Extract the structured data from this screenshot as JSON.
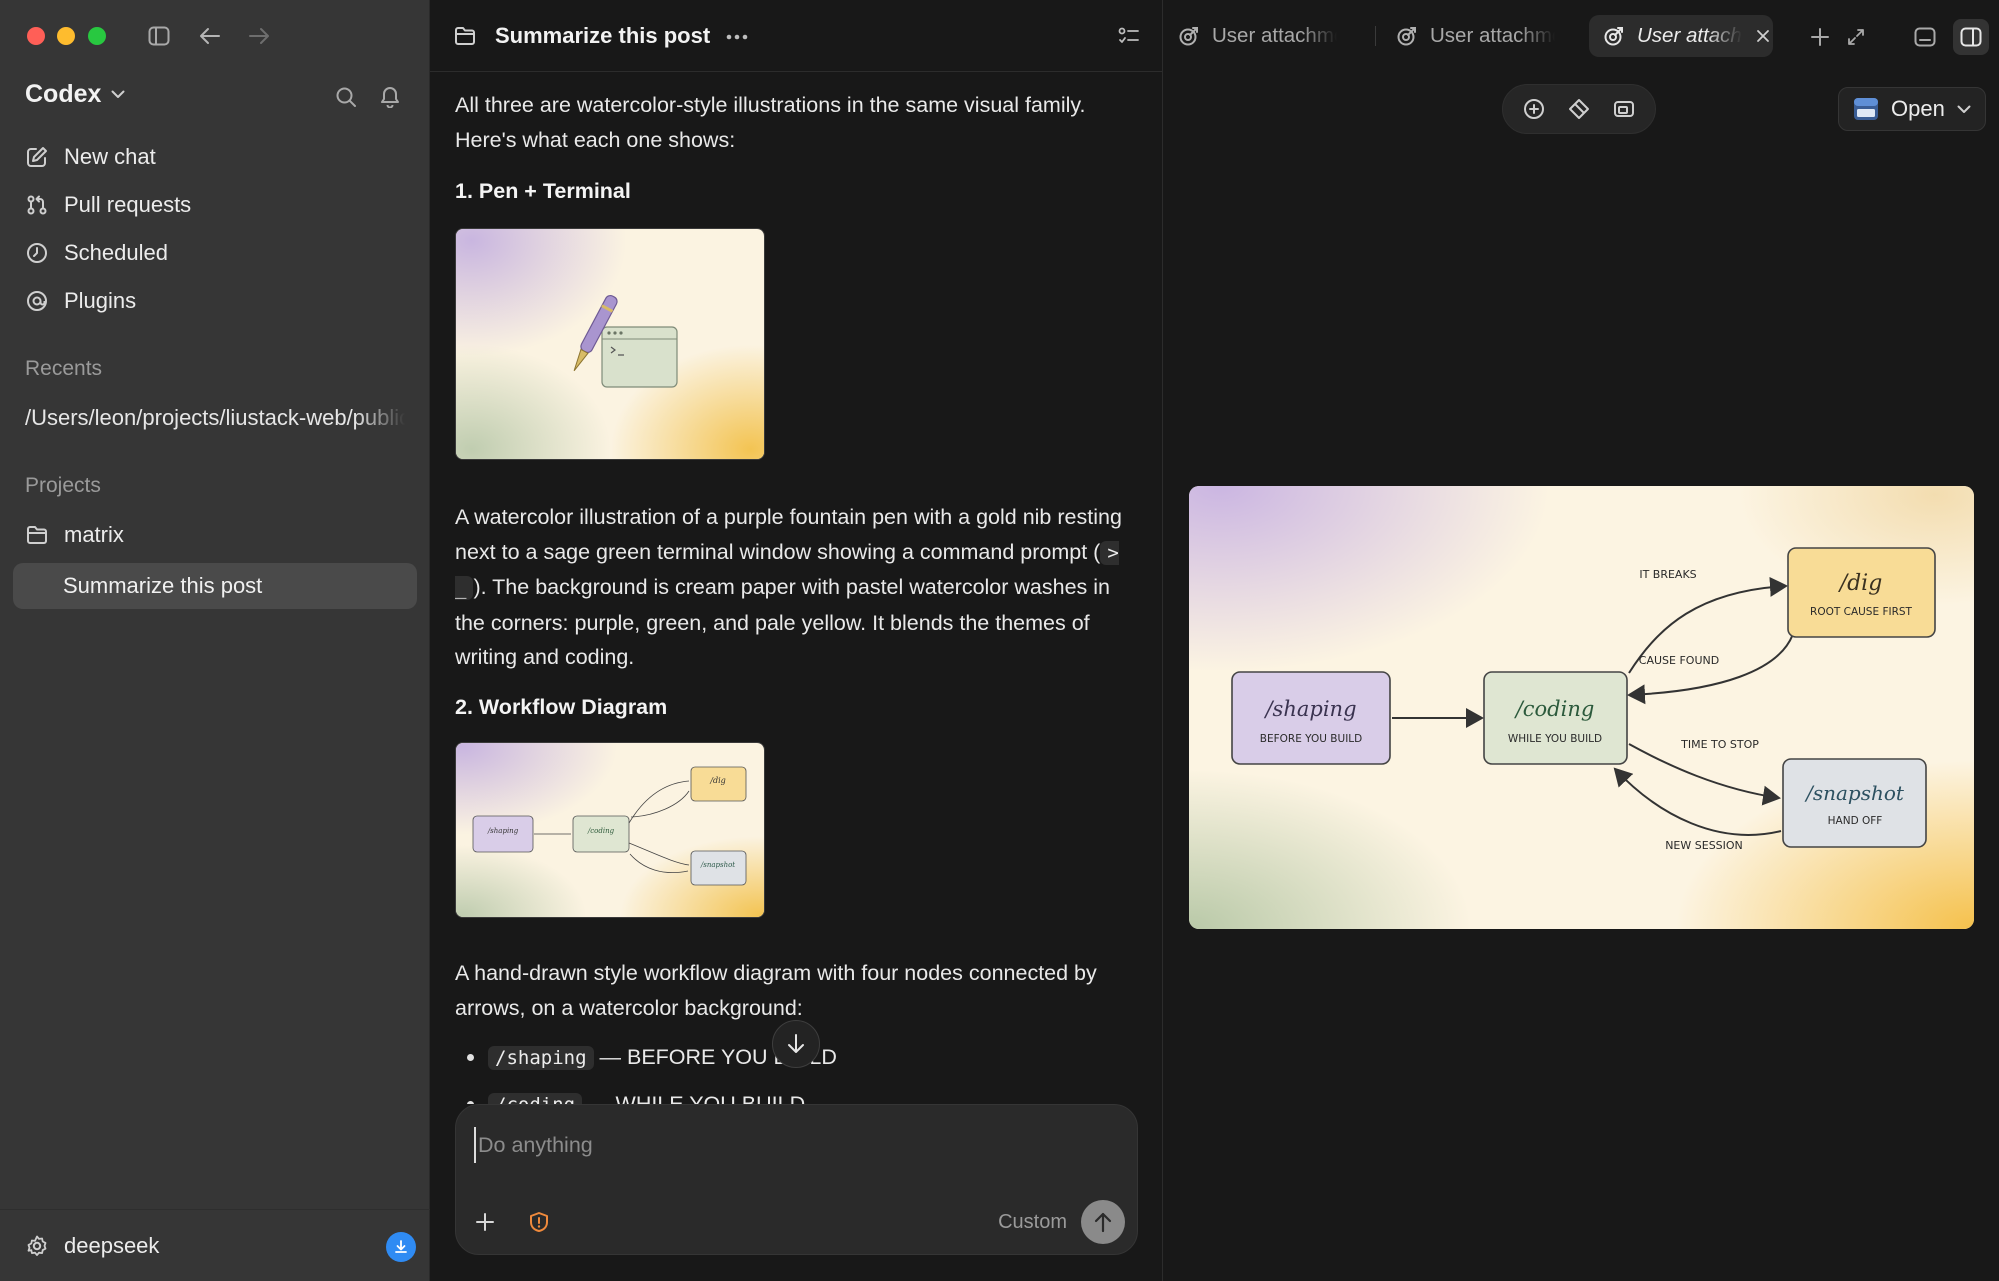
{
  "window": {
    "traffic_lights": [
      "close",
      "minimize",
      "zoom"
    ],
    "colors": {
      "close": "#ff5f57",
      "minimize": "#febc2e",
      "zoom": "#28c840",
      "accent": "#2f8bf3"
    }
  },
  "sidebar": {
    "app_title": "Codex",
    "nav": [
      {
        "label": "New chat",
        "icon": "compose-icon"
      },
      {
        "label": "Pull requests",
        "icon": "git-pull-request-icon"
      },
      {
        "label": "Scheduled",
        "icon": "clock-icon"
      },
      {
        "label": "Plugins",
        "icon": "plugin-icon"
      }
    ],
    "recents_label": "Recents",
    "recent_path": "/Users/leon/projects/liustack-web/public",
    "projects_label": "Projects",
    "project": {
      "name": "matrix",
      "icon": "folder-icon"
    },
    "active_thread": "Summarize this post",
    "footer": {
      "label": "deepseek",
      "icon": "gear-icon",
      "badge_icon": "download-icon"
    }
  },
  "chat": {
    "title": "Summarize this post",
    "intro": "All three are watercolor-style illustrations in the same visual family. Here's what each one shows:",
    "section1": {
      "heading": "1. Pen + Terminal",
      "desc_before": "A watercolor illustration of a purple fountain pen with a gold nib resting next to a sage green terminal window showing a command prompt (",
      "code": "> _",
      "desc_after": "). The background is cream paper with pastel watercolor washes in the corners: purple, green, and pale yellow. It blends the themes of writing and coding."
    },
    "section2": {
      "heading": "2. Workflow Diagram",
      "desc": "A hand-drawn style workflow diagram with four nodes connected by arrows, on a watercolor background:",
      "bullets": [
        {
          "code": "/shaping",
          "text": "— BEFORE YOU BUILD"
        },
        {
          "code": "/coding",
          "text": "— WHILE YOU BUILD"
        }
      ]
    },
    "composer": {
      "placeholder": "Do anything",
      "model": "Custom"
    }
  },
  "preview": {
    "tabs": [
      {
        "label": "User attachment",
        "active": false
      },
      {
        "label": "User attachment",
        "active": false
      },
      {
        "label": "User attachment",
        "active": true
      }
    ],
    "open_label": "Open",
    "diagram": {
      "nodes": [
        {
          "id": "shaping",
          "title": "/shaping",
          "subtitle": "BEFORE YOU BUILD",
          "color": "#d9cde8"
        },
        {
          "id": "coding",
          "title": "/coding",
          "subtitle": "WHILE YOU BUILD",
          "color": "#dfe6d2"
        },
        {
          "id": "dig",
          "title": "/dig",
          "subtitle": "ROOT CAUSE FIRST",
          "color": "#f8dc96"
        },
        {
          "id": "snapshot",
          "title": "/snapshot",
          "subtitle": "HAND OFF",
          "color": "#dfe2e6"
        }
      ],
      "edges": [
        {
          "label": "IT BREAKS"
        },
        {
          "label": "CAUSE FOUND"
        },
        {
          "label": "TIME TO STOP"
        },
        {
          "label": "NEW SESSION"
        }
      ]
    }
  }
}
